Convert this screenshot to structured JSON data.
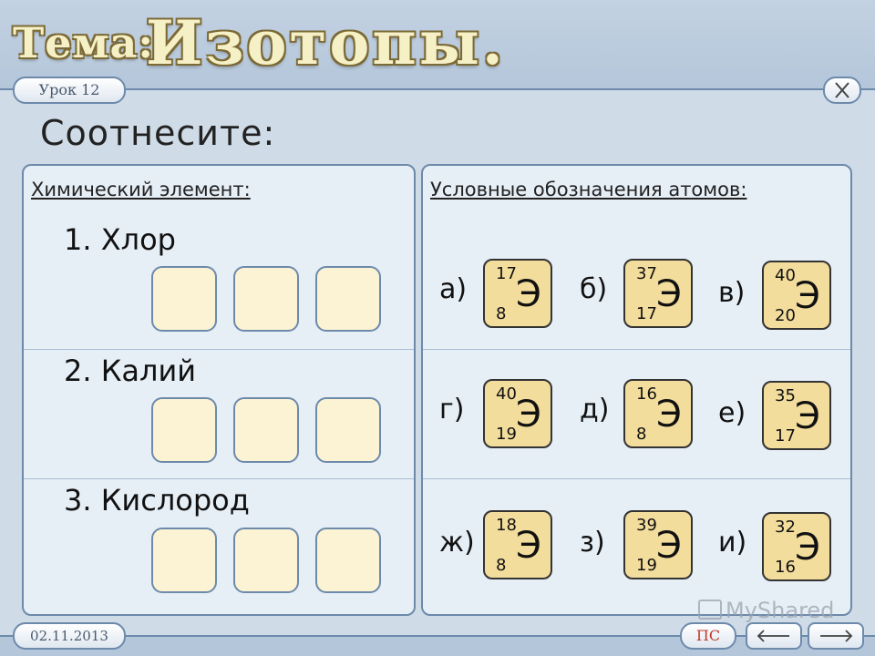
{
  "header": {
    "tema_label": "Тема:",
    "topic": "Изотопы.",
    "lesson": "Урок 12"
  },
  "main": {
    "heading": "Соотнесите:",
    "left_title": "Химический элемент:",
    "right_title": "Условные обозначения атомов:",
    "elements": [
      {
        "label": "1. Хлор"
      },
      {
        "label": "2. Калий"
      },
      {
        "label": "3. Кислород"
      }
    ],
    "options": [
      {
        "label": "а)",
        "mass": "17",
        "number": "8",
        "symbol": "Э"
      },
      {
        "label": "б)",
        "mass": "37",
        "number": "17",
        "symbol": "Э"
      },
      {
        "label": "в)",
        "mass": "40",
        "number": "20",
        "symbol": "Э"
      },
      {
        "label": "г)",
        "mass": "40",
        "number": "19",
        "symbol": "Э"
      },
      {
        "label": "д)",
        "mass": "16",
        "number": "8",
        "symbol": "Э"
      },
      {
        "label": "е)",
        "mass": "35",
        "number": "17",
        "symbol": "Э"
      },
      {
        "label": "ж)",
        "mass": "18",
        "number": "8",
        "symbol": "Э"
      },
      {
        "label": "з)",
        "mass": "39",
        "number": "19",
        "symbol": "Э"
      },
      {
        "label": "и)",
        "mass": "32",
        "number": "16",
        "symbol": "Э"
      }
    ]
  },
  "footer": {
    "date": "02.11.2013",
    "ps_label": "ПС",
    "watermark": "MyShared"
  },
  "icons": {
    "close": "close-icon",
    "prev": "arrow-left-icon",
    "next": "arrow-right-icon"
  },
  "colors": {
    "slot_fill": "#fbf3d3",
    "symbol_fill": "#f3dd9c",
    "border": "#6d8aab"
  }
}
